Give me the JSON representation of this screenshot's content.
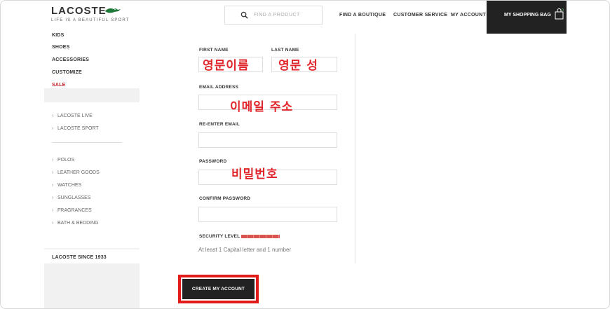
{
  "header": {
    "logo": "LACOSTE",
    "tagline": "LIFE IS A BEAUTIFUL SPORT",
    "search_placeholder": "FIND A PRODUCT",
    "nav": [
      "FIND A BOUTIQUE",
      "CUSTOMER SERVICE",
      "MY ACCOUNT"
    ],
    "bag_label": "MY SHOPPING BAG",
    "bag_count": "0"
  },
  "sidebar": {
    "top_items": [
      "KIDS",
      "SHOES",
      "ACCESSORIES",
      "CUSTOMIZE",
      "SALE"
    ],
    "group1": [
      "LACOSTE LIVE",
      "LACOSTE SPORT"
    ],
    "group2": [
      "POLOS",
      "LEATHER GOODS",
      "WATCHES",
      "SUNGLASSES",
      "FRAGRANCES",
      "BATH & BEDDING"
    ],
    "footer": "LACOSTE SINCE 1933"
  },
  "form": {
    "first_name_label": "FIRST NAME",
    "last_name_label": "LAST NAME",
    "first_name_note": "영문이름",
    "last_name_note": "영문 성",
    "email_label": "EMAIL ADDRESS",
    "email_note": "이메일 주소",
    "reenter_email_label": "RE-ENTER EMAIL",
    "password_label": "PASSWORD",
    "password_note": "비밀번호",
    "confirm_password_label": "CONFIRM PASSWORD",
    "security_label": "SECURITY LEVEL",
    "hint": "At least 1 Capital letter and 1 number",
    "submit_label": "CREATE MY ACCOUNT"
  },
  "colors": {
    "accent_red": "#e11a1a",
    "sale_red": "#c41e2b",
    "dark": "#222222",
    "logo_green": "#1f7a3a"
  },
  "icons": {
    "search": "search-icon",
    "bag": "shopping-bag-icon",
    "croc": "crocodile-logo-icon",
    "chevron": "chevron-right-icon"
  }
}
